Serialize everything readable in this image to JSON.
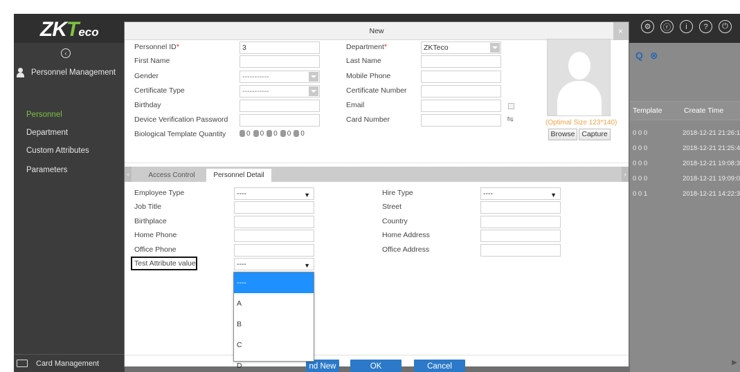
{
  "app": {
    "logo_main": "ZK",
    "logo_t": "T",
    "logo_eco": "eco"
  },
  "topbar": {
    "icons": [
      "gear-icon",
      "user-icon",
      "info-icon",
      "help-icon",
      "power-icon"
    ],
    "icon_glyphs": [
      "⚙",
      "ⓡ",
      "i",
      "?",
      "⏻"
    ]
  },
  "sidebar": {
    "collapse_glyph": "‹",
    "group_label": "Personnel Management",
    "items": [
      {
        "label": "Personnel",
        "active": true
      },
      {
        "label": "Department",
        "active": false
      },
      {
        "label": "Custom Attributes",
        "active": false
      },
      {
        "label": "Parameters",
        "active": false
      }
    ],
    "bottom_label": "Card Management"
  },
  "list": {
    "search_glyph": "Q",
    "clear_glyph": "⊗",
    "headers": [
      "Template",
      "Create Time"
    ],
    "rows": [
      {
        "template": "0 0 0",
        "time": "2018-12-21 21:26:1"
      },
      {
        "template": "0 0 0",
        "time": "2018-12-21 21:25:4"
      },
      {
        "template": "0 0 0",
        "time": "2018-12-21 19:08:3"
      },
      {
        "template": "0 0 0",
        "time": "2018-12-21 19:09:0"
      },
      {
        "template": "0 0 1",
        "time": "2018-12-21 14:22:3"
      }
    ],
    "scroll_glyph": "▶"
  },
  "modal": {
    "title": "New",
    "close_glyph": "×",
    "basic": {
      "personnel_id_label": "Personnel ID",
      "personnel_id_value": "3",
      "first_name_label": "First Name",
      "gender_label": "Gender",
      "gender_value": "-----------",
      "certificate_type_label": "Certificate Type",
      "certificate_type_value": "-----------",
      "birthday_label": "Birthday",
      "device_password_label": "Device Verification Password",
      "bio_label": "Biological Template Quantity",
      "bio_values": [
        "0",
        "0",
        "0",
        "0",
        "0"
      ],
      "department_label": "Department",
      "department_value": "ZKTeco",
      "last_name_label": "Last Name",
      "mobile_label": "Mobile Phone",
      "certificate_number_label": "Certificate Number",
      "email_label": "Email",
      "card_number_label": "Card Number",
      "required_mark": "*"
    },
    "photo": {
      "optimal_text": "(Optimal Size 123*140)",
      "browse_label": "Browse",
      "capture_label": "Capture"
    },
    "tabs": [
      {
        "label": "Access Control",
        "active": false
      },
      {
        "label": "Personnel Detail",
        "active": true
      }
    ],
    "tab_scroll_left": "‹",
    "tab_scroll_right": "›",
    "detail": {
      "employee_type_label": "Employee Type",
      "employee_type_value": "----",
      "job_title_label": "Job Title",
      "birthplace_label": "Birthplace",
      "home_phone_label": "Home Phone",
      "office_phone_label": "Office Phone",
      "test_attr_label": "Test Attribute value",
      "test_attr_value": "----",
      "hire_type_label": "Hire Type",
      "hire_type_value": "----",
      "street_label": "Street",
      "country_label": "Country",
      "home_address_label": "Home Address",
      "office_address_label": "Office Address"
    },
    "dropdown": {
      "options": [
        "----",
        "A",
        "B",
        "C",
        "D"
      ],
      "selected": "----"
    },
    "buttons": {
      "save_and_new": "nd New",
      "ok": "OK",
      "cancel": "Cancel"
    }
  },
  "colors": {
    "brand_green": "#7dc242",
    "primary_blue": "#2b79c8",
    "dropdown_highlight": "#1e90ff",
    "required_red": "#e23a3a",
    "hint_orange": "#f0a14a"
  }
}
